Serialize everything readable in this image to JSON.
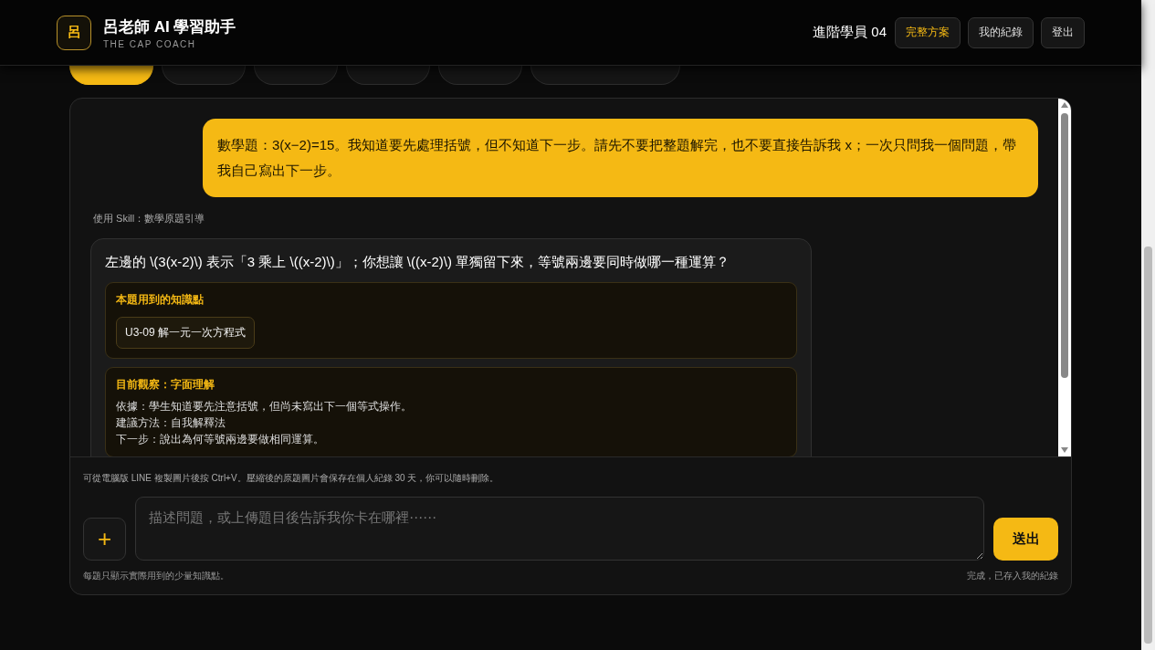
{
  "header": {
    "logo_mark": "呂",
    "title": "呂老師 AI 學習助手",
    "subtitle": "THE CAP COACH",
    "user": "進階學員 04",
    "buttons": [
      {
        "label": "完整方案",
        "kind": "highlight"
      },
      {
        "label": "我的紀錄",
        "kind": "normal"
      },
      {
        "label": "登出",
        "kind": "normal"
      }
    ]
  },
  "tabs": [
    {
      "selected": true
    },
    {
      "selected": false
    },
    {
      "selected": false
    },
    {
      "selected": false
    },
    {
      "selected": false
    },
    {
      "selected": false
    }
  ],
  "chat": {
    "user_message": "數學題：3(x−2)=15。我知道要先處理括號，但不知道下一步。請先不要把整題解完，也不要直接告訴我 x；一次只問我一個問題，帶我自己寫出下一步。",
    "skill_note": "使用 Skill：數學原題引導",
    "reply": {
      "question": "左邊的 \\(3(x-2)\\) 表示「3 乘上 \\((x-2)\\)」；你想讓 \\((x-2)\\) 單獨留下來，等號兩邊要同時做哪一種運算？",
      "knowledge": {
        "title": "本題用到的知識點",
        "tags": [
          "U3-09 解一元一次方程式"
        ]
      },
      "observation": {
        "title": "目前觀察：字面理解",
        "lines": [
          "依據：學生知道要先注意括號，但尚未寫出下一個等式操作。",
          "建議方法：自我解釋法",
          "下一步：說出為何等號兩邊要做相同運算。"
        ]
      }
    }
  },
  "composer": {
    "hint": "可從電腦版 LINE 複製圖片後按 Ctrl+V。壓縮後的原題圖片會保存在個人紀錄 30 天，你可以隨時刪除。",
    "attach": "+",
    "placeholder": "描述問題，或上傳題目後告訴我你卡在哪裡⋯⋯",
    "send": "送出",
    "footer_left": "每題只顯示實際用到的少量知識點。",
    "footer_right": "完成，已存入我的紀錄"
  }
}
